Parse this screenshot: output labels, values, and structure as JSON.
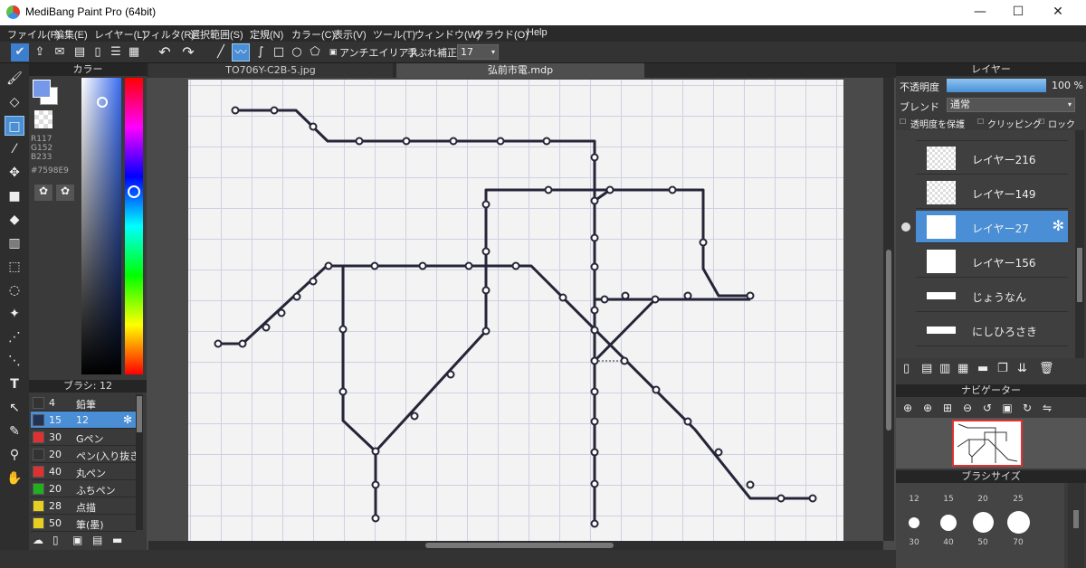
{
  "window": {
    "title": "MediBang Paint Pro (64bit)",
    "minimize": "—",
    "maximize": "☐",
    "close": "✕"
  },
  "menu": [
    "ファイル(F)",
    "編集(E)",
    "レイヤー(L)",
    "フィルタ(R)",
    "選択範囲(S)",
    "定規(N)",
    "カラー(C)",
    "表示(V)",
    "ツール(T)",
    "ウィンドウ(W)",
    "クラウド(O)",
    "Help"
  ],
  "toolbar": {
    "antialias": "アンチエイリアス",
    "stabilizer_label": "手ぶれ補正",
    "stabilizer_value": "17"
  },
  "color_panel": {
    "title": "カラー",
    "r": "R117",
    "g": "G152",
    "b": "B233",
    "hex": "#7598E9",
    "current_color": "#7598e9"
  },
  "doc_tabs": [
    "TO706Y-C2B-5.jpg",
    "弘前市電.mdp"
  ],
  "brush_panel": {
    "title": "ブラシ: 12",
    "items": [
      {
        "size": "4",
        "name": "鉛筆",
        "color": "#333333"
      },
      {
        "size": "15",
        "name": "12",
        "color": "#223355"
      },
      {
        "size": "30",
        "name": "Gペン",
        "color": "#e03030"
      },
      {
        "size": "20",
        "name": "ペン(入り抜き)",
        "color": "#333333"
      },
      {
        "size": "40",
        "name": "丸ペン",
        "color": "#e03030"
      },
      {
        "size": "20",
        "name": "ふちペン",
        "color": "#20b020"
      },
      {
        "size": "28",
        "name": "点描",
        "color": "#e8d020"
      },
      {
        "size": "50",
        "name": "筆(墨)",
        "color": "#e8d020"
      }
    ]
  },
  "layer_panel": {
    "title": "レイヤー",
    "opacity_label": "不透明度",
    "opacity_value": "100 %",
    "opacity_fraction": 1.0,
    "blend_label": "ブレンド",
    "blend_value": "通常",
    "protect_label": "透明度を保護",
    "clipping_label": "クリッピング",
    "lock_label": "ロック",
    "layers": [
      {
        "name": "レイヤー216",
        "selected": false
      },
      {
        "name": "レイヤー149",
        "selected": false
      },
      {
        "name": "レイヤー27",
        "selected": true
      },
      {
        "name": "レイヤー156",
        "selected": false
      },
      {
        "name": "じょうなん",
        "selected": false
      },
      {
        "name": "にしひろさき",
        "selected": false
      }
    ]
  },
  "navigator": {
    "title": "ナビゲーター"
  },
  "brush_size": {
    "title": "ブラシサイズ",
    "sizes_top": [
      "12",
      "15",
      "20",
      "25"
    ],
    "sizes_bottom": [
      "30",
      "40",
      "50",
      "70"
    ]
  }
}
